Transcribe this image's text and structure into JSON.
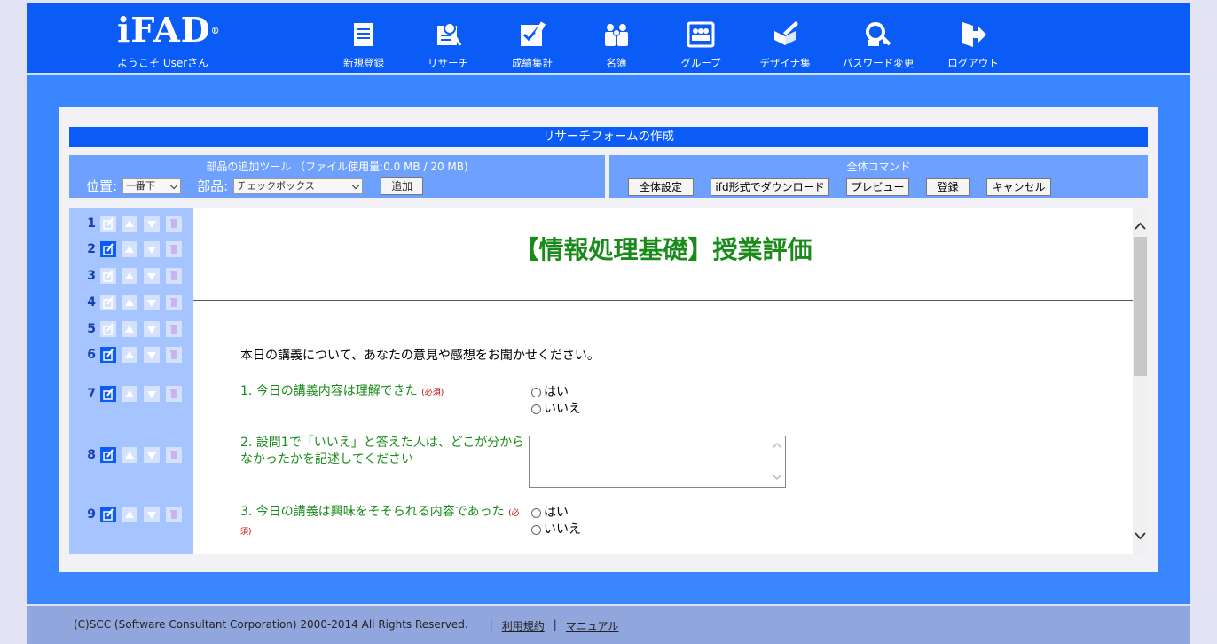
{
  "header": {
    "logo": "iFAD",
    "logo_mark": "®",
    "welcome": "ようこそ Userさん",
    "nav": [
      {
        "label": "新規登録",
        "icon": "new-document-icon"
      },
      {
        "label": "リサーチ",
        "icon": "research-icon"
      },
      {
        "label": "成績集計",
        "icon": "grades-icon"
      },
      {
        "label": "名簿",
        "icon": "roster-icon"
      },
      {
        "label": "グループ",
        "icon": "group-icon"
      },
      {
        "label": "デザイナ集",
        "icon": "designer-icon"
      },
      {
        "label": "パスワード変更",
        "icon": "password-icon"
      },
      {
        "label": "ログアウト",
        "icon": "logout-icon"
      }
    ]
  },
  "page_title": "リサーチフォームの作成",
  "tools": {
    "title": "部品の追加ツール （ファイル使用量:0.0 MB / 20 MB)",
    "position_label": "位置:",
    "position_value": "一番下",
    "part_label": "部品:",
    "part_value": "チェックボックス",
    "add_button": "追加"
  },
  "commands": {
    "title": "全体コマンド",
    "buttons": [
      "全体設定",
      "ifd形式でダウンロード",
      "プレビュー",
      "登録",
      "キャンセル"
    ]
  },
  "rows": [
    "1",
    "2",
    "3",
    "4",
    "5",
    "6",
    "7",
    "8",
    "9"
  ],
  "form": {
    "title": "【情報処理基礎】授業評価",
    "intro": "本日の講義について、あなたの意見や感想をお聞かせください。",
    "required_mark": "(必須)",
    "q1": "1. 今日の講義内容は理解できた",
    "q2": "2. 設問1で「いいえ」と答えた人は、どこが分からなかったかを記述してください",
    "q3": "3. 今日の講義は興味をそそられる内容であった",
    "yes": "はい",
    "no": "いいえ"
  },
  "footer": {
    "copyright": "(C)SCC (Software Consultant Corporation) 2000-2014 All Rights Reserved.",
    "sep": "|",
    "terms": "利用規約",
    "manual": "マニュアル"
  },
  "colors": {
    "header": "#0b5cf6",
    "main": "#3a86ff",
    "toolbar": "#6ea0ff",
    "question": "#1a8a1a",
    "required": "#cc0000"
  }
}
